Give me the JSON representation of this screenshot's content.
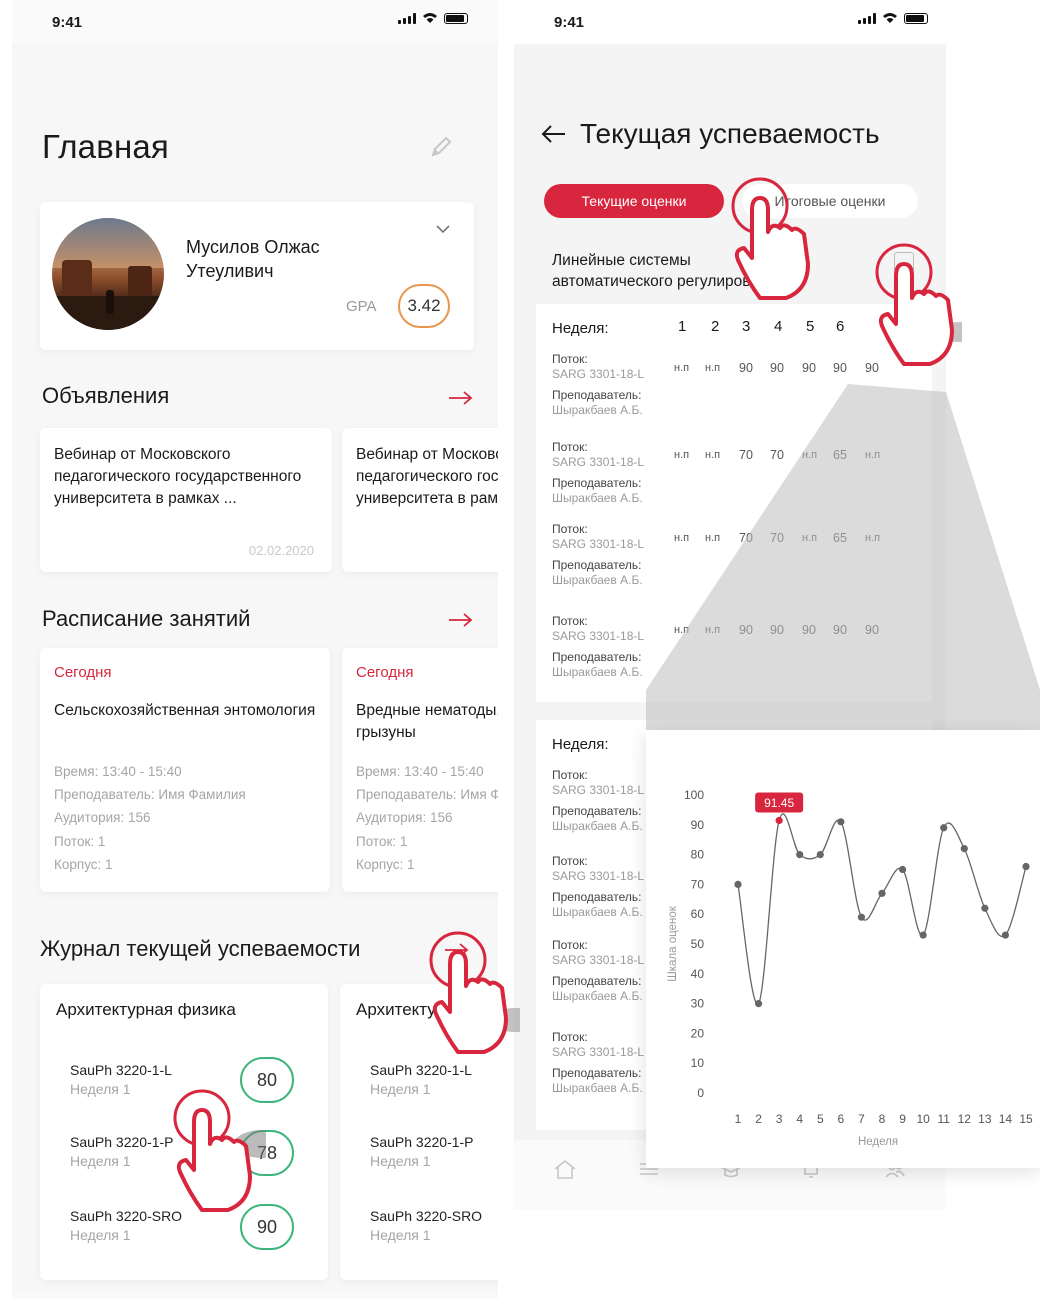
{
  "left_screen": {
    "status_time": "9:41",
    "title": "Главная",
    "profile": {
      "name_line1": "Мусилов Олжас",
      "name_line2": "Утеуливич",
      "gpa_label": "GPA",
      "gpa_value": "3.42"
    },
    "announcements": {
      "title": "Объявления",
      "items": [
        {
          "text": "Вебинар от Московского педагогического государственного университета в рамках ...",
          "date": "02.02.2020"
        },
        {
          "text": "Вебинар от Московского педагогического государственного университета в рамках ..."
        }
      ]
    },
    "schedule": {
      "title": "Расписание занятий",
      "items": [
        {
          "day": "Сегодня",
          "subject": "Сельскохозяйственная энтомология",
          "time": "Время: 13:40 - 15:40",
          "teacher": "Преподаватель: Имя Фамилия",
          "room": "Аудитория: 156",
          "stream": "Поток: 1",
          "building": "Корпус: 1"
        },
        {
          "day": "Сегодня",
          "subject": "Вредные нематоды, клещи и грызуны",
          "time": "Время: 13:40 - 15:40",
          "teacher": "Преподаватель: Имя Фамилия",
          "room": "Аудитория: 156",
          "stream": "Поток: 1",
          "building": "Корпус: 1"
        }
      ]
    },
    "journal": {
      "title": "Журнал текущей успеваемости",
      "cards": [
        {
          "title": "Архитектурная физика",
          "rows": [
            {
              "code": "SauPh 3220-1-L",
              "week": "Неделя 1",
              "score": "80"
            },
            {
              "code": "SauPh 3220-1-P",
              "week": "Неделя 1",
              "score": "78"
            },
            {
              "code": "SauPh 3220-SRO",
              "week": "Неделя 1",
              "score": "90"
            }
          ]
        },
        {
          "title": "Архитектурная физика",
          "rows": [
            {
              "code": "SauPh 3220-1-L",
              "week": "Неделя 1"
            },
            {
              "code": "SauPh 3220-1-P",
              "week": "Неделя 1"
            },
            {
              "code": "SauPh 3220-SRO",
              "week": "Неделя 1"
            }
          ]
        }
      ]
    }
  },
  "right_screen": {
    "status_time": "9:41",
    "title": "Текущая успеваемость",
    "tab_current": "Текущие оценки",
    "tab_final": "Итоговые оценки",
    "subject_line1": "Линейные системы",
    "subject_line2": "автоматического регулирования",
    "week_label": "Неделя:",
    "weeks": [
      "1",
      "2",
      "3",
      "4",
      "5",
      "6"
    ],
    "stream_label": "Поток:",
    "stream_value": "SARG 3301-18-L",
    "teacher_label": "Преподаватель:",
    "teacher_value": "Шыракбаев А.Б.",
    "rows": [
      [
        "н.п",
        "н.п",
        "90",
        "90",
        "90",
        "90",
        "90"
      ],
      [
        "н.п",
        "н.п",
        "70",
        "70",
        "н.п",
        "65",
        "н.п"
      ],
      [
        "н.п",
        "н.п",
        "70",
        "70",
        "н.п",
        "65",
        "н.п"
      ],
      [
        "н.п",
        "н.п",
        "90",
        "90",
        "90",
        "90",
        "90"
      ]
    ]
  },
  "colors": {
    "accent_red": "#d7263d",
    "gpa_orange": "#e8964a",
    "score_green": "#3cb57a"
  },
  "chart_data": {
    "type": "line",
    "title": "",
    "xlabel": "Неделя",
    "ylabel": "Шкала оценок",
    "x": [
      1,
      2,
      3,
      4,
      5,
      6,
      7,
      8,
      9,
      10,
      11,
      12,
      13,
      14,
      15
    ],
    "ylim": [
      0,
      100
    ],
    "yticks": [
      0,
      10,
      20,
      30,
      40,
      50,
      60,
      70,
      80,
      90,
      100
    ],
    "series": [
      {
        "values": [
          70,
          30,
          91.45,
          80,
          80,
          91,
          59,
          67,
          75,
          53,
          89,
          82,
          62,
          53,
          76
        ]
      }
    ],
    "highlight": {
      "x": 3,
      "label": "91.45"
    }
  }
}
